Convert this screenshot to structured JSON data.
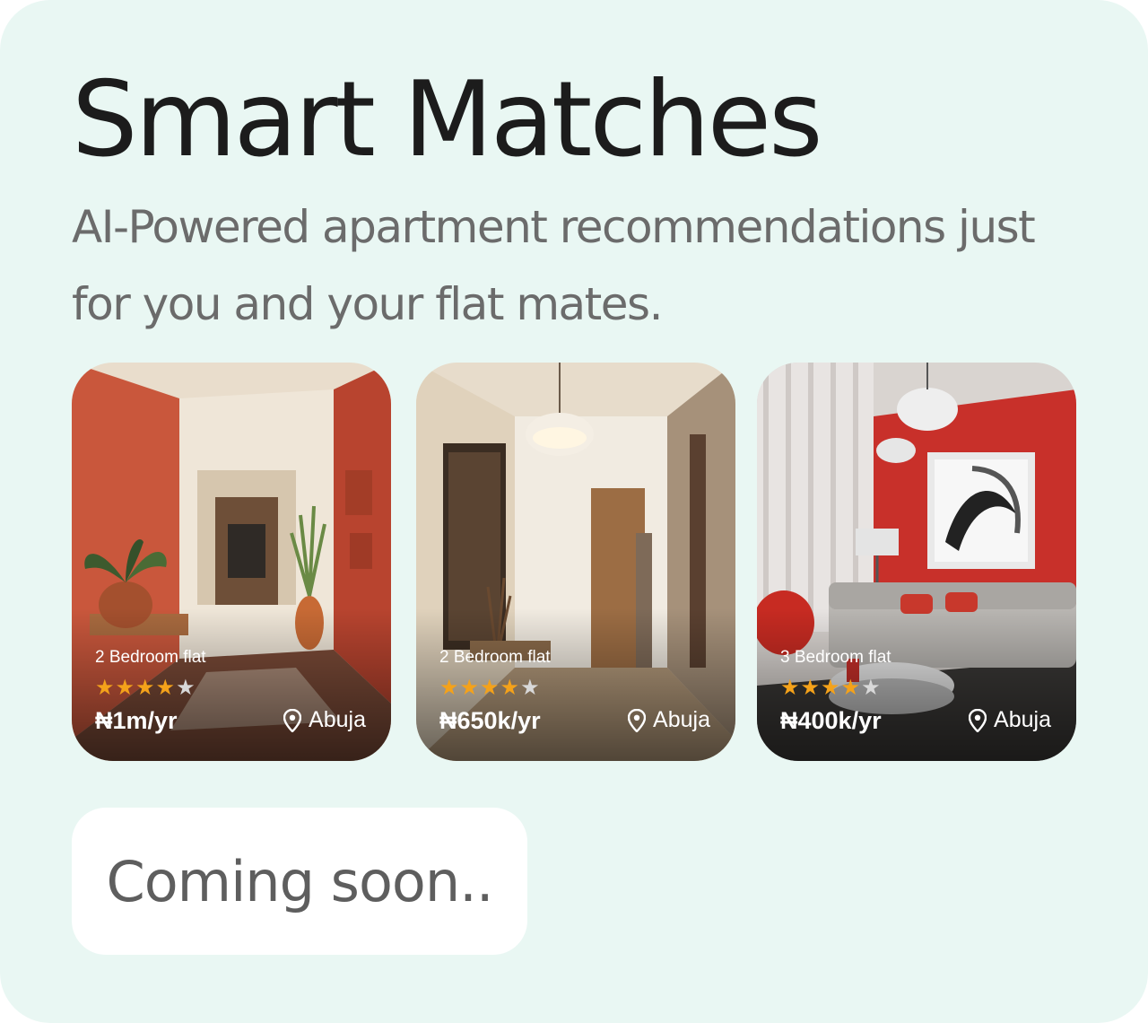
{
  "header": {
    "title": "Smart Matches",
    "subtitle": "AI-Powered apartment recommendations just for you and your flat mates."
  },
  "listings": [
    {
      "type": "2 Bedroom flat",
      "rating": 4,
      "max_rating": 5,
      "price": "₦1m/yr",
      "location": "Abuja"
    },
    {
      "type": "2 Bedroom flat",
      "rating": 4,
      "max_rating": 5,
      "price": "₦650k/yr",
      "location": "Abuja"
    },
    {
      "type": "3 Bedroom flat",
      "rating": 4,
      "max_rating": 5,
      "price": "₦400k/yr",
      "location": "Abuja"
    }
  ],
  "cta": {
    "label": "Coming soon.."
  },
  "colors": {
    "background": "#e9f7f3",
    "title": "#1c1c1c",
    "subtitle": "#6b6b6b",
    "star_on": "#f4a21a",
    "star_off": "#d8d8d8"
  },
  "icons": {
    "location": "map-pin-icon",
    "rating": "star-icon"
  }
}
